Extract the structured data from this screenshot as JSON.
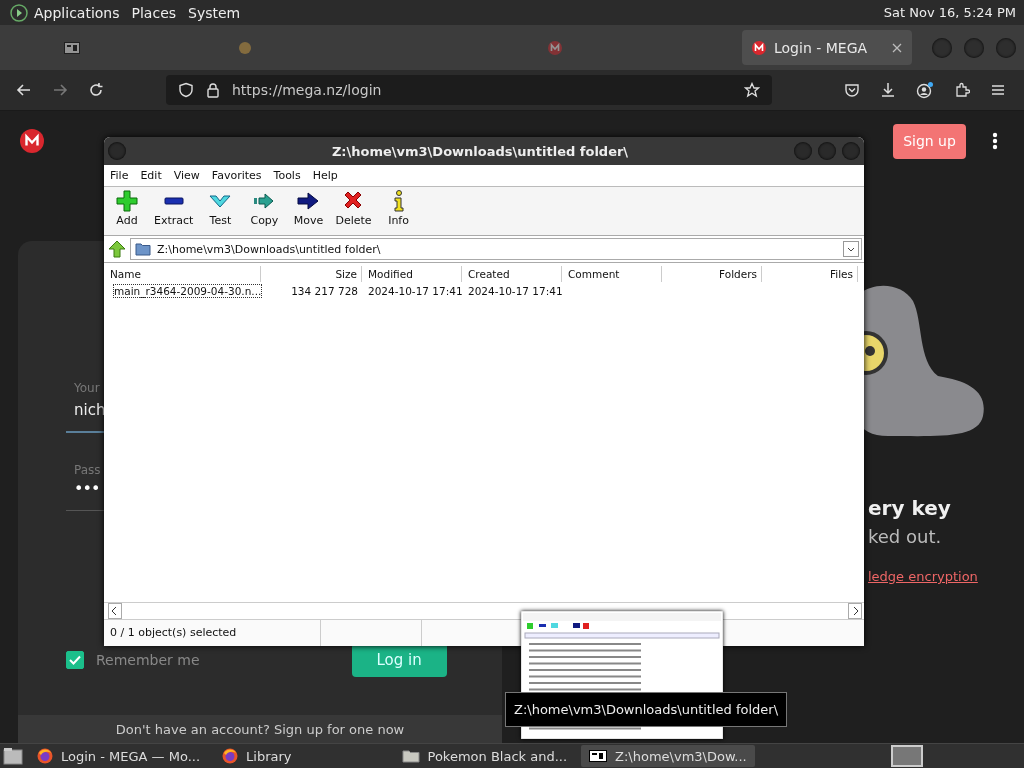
{
  "top_panel": {
    "menus": [
      "Applications",
      "Places",
      "System"
    ],
    "clock": "Sat Nov 16,  5:24 PM"
  },
  "browser": {
    "tabs": [
      {
        "kind": "archive",
        "selected": false
      },
      {
        "kind": "globe",
        "selected": false
      },
      {
        "kind": "mega",
        "selected": false
      },
      {
        "kind": "mega",
        "title": "Login - MEGA",
        "selected": true
      }
    ],
    "url": "https://mega.nz/login"
  },
  "page": {
    "signup_button": "Sign up",
    "login": {
      "email_label": "Your",
      "email_value": "nich",
      "password_label": "Pass",
      "password_value": "•••",
      "remember": {
        "label": "Remember me",
        "checked": true
      },
      "login_button": "Log in",
      "footer": "Don't have an account? Sign up for one now"
    },
    "side": {
      "heading": "ery key",
      "text": "ked out.",
      "link": "ledge encryption"
    }
  },
  "archiver": {
    "title": "Z:\\home\\vm3\\Downloads\\untitled folder\\",
    "menu": [
      "File",
      "Edit",
      "View",
      "Favorites",
      "Tools",
      "Help"
    ],
    "toolbar": [
      {
        "kind": "add",
        "label": "Add"
      },
      {
        "kind": "extract",
        "label": "Extract"
      },
      {
        "kind": "test",
        "label": "Test"
      },
      {
        "kind": "copy",
        "label": "Copy"
      },
      {
        "kind": "move",
        "label": "Move"
      },
      {
        "kind": "delete",
        "label": "Delete"
      },
      {
        "kind": "info",
        "label": "Info"
      }
    ],
    "address": "Z:\\home\\vm3\\Downloads\\untitled folder\\",
    "columns": [
      "Name",
      "Size",
      "Modified",
      "Created",
      "Comment",
      "Folders",
      "Files"
    ],
    "rows": [
      {
        "focused": true,
        "cells": [
          "main_r3464-2009-04-30.n...",
          "134 217 728",
          "2024-10-17 17:41",
          "2024-10-17 17:41",
          "",
          "",
          ""
        ]
      }
    ],
    "status": "0 / 1 object(s) selected"
  },
  "taskbar": {
    "items": [
      {
        "kind": "firefox",
        "label": "Login - MEGA — Mo...",
        "selected": false
      },
      {
        "kind": "firefox",
        "label": "Library",
        "selected": false
      },
      {
        "kind": "folder",
        "label": "Pokemon Black and...",
        "selected": false
      },
      {
        "kind": "archive",
        "label": "Z:\\home\\vm3\\Dow...",
        "selected": true
      }
    ],
    "tooltip": "Z:\\home\\vm3\\Downloads\\untitled folder\\"
  }
}
